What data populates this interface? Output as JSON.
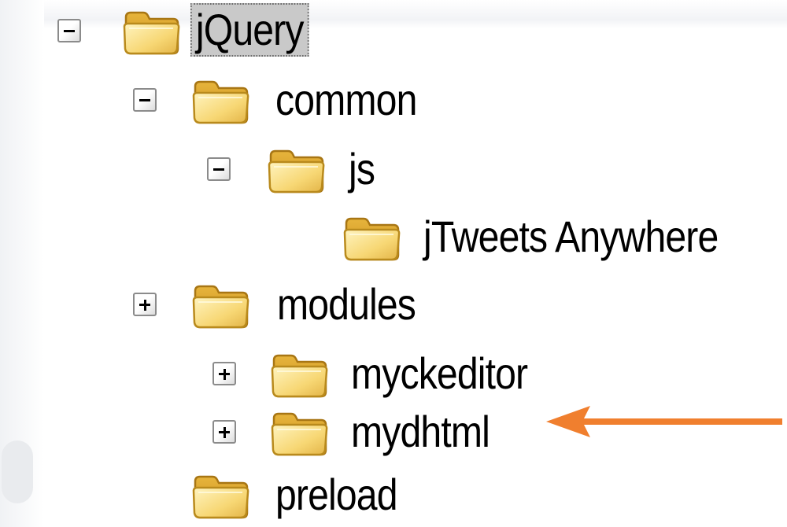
{
  "tree": {
    "root": {
      "label": "jQuery",
      "expanded": true,
      "selected": true
    },
    "items": {
      "common": {
        "label": "common",
        "expanded": true
      },
      "js": {
        "label": "js",
        "expanded": true
      },
      "jtweets": {
        "label": "jTweets Anywhere"
      },
      "modules": {
        "label": "modules",
        "expanded": false
      },
      "myckeditor": {
        "label": "myckeditor",
        "expanded": false
      },
      "mydhtml": {
        "label": "mydhtml",
        "expanded": false
      },
      "preload": {
        "label": "preload"
      }
    }
  },
  "icons": {
    "folder": "folder-icon",
    "expand": "plus-icon",
    "collapse": "minus-icon"
  },
  "annotation": {
    "arrow_color": "#f07f2e",
    "points_to": "mydhtml"
  },
  "colors": {
    "selection_bg": "#c9c9c9",
    "folder_fill": "#f7d774",
    "folder_stroke": "#b98a1c"
  }
}
